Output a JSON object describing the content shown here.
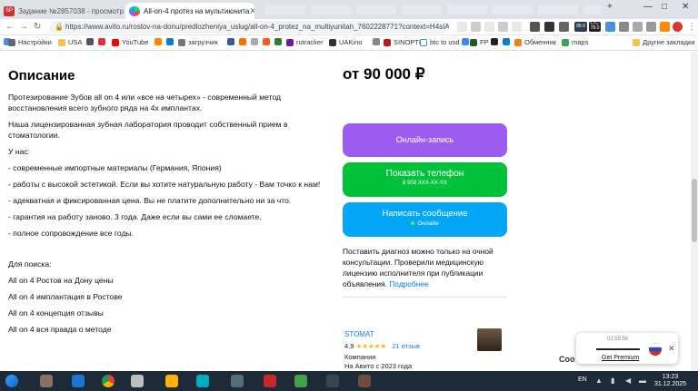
{
  "browser": {
    "tabs": [
      {
        "title": "Задание №2857038 - просмотр з",
        "favicon_label": "SP",
        "active": false
      },
      {
        "title": "All-on-4 протез на мультиюнита",
        "active": true
      }
    ],
    "url": "https://www.avito.ru/rostov-na-donu/predlozheniya_uslug/all-on-4_protez_na_multiyunitah_7602228771?context=H4sIAAAAA...",
    "bookmarks": [
      "Настройки",
      "USA",
      "YouTube",
      "загрузчик",
      "rutracker",
      "UAKino",
      "SINOPTIK",
      "btc to usd",
      "FP",
      "Обменник",
      "maps",
      "Другие закладки"
    ],
    "extension_badges": {
      "ltc": "LTC",
      "ltc_value": "78.0",
      "btc_value": "88.0"
    }
  },
  "listing": {
    "description_title": "Описание",
    "description_paragraphs": [
      "Протезирование Зубов all on 4 или «все на четырех» - современный метод восстановления всего зубного ряда на 4х имплантах.",
      "Наша лицензированная зубная лаборатория проводит собственный прием в стоматологии.",
      "У нас:",
      "- современные импортные материалы (Германия, Япония)",
      "- работы с высокой эстетикой. Если вы хотите натуральную работу - Вам точко к нам!",
      "- адекватная и фиксированная цена. Вы не платите дополнительно ни за что.",
      "- гарантия на работу заново. 3 года. Даже если вы сами ее сломаете.",
      "- полное сопровождение все годы.",
      "",
      "Для поиска:",
      "All on 4 Ростов на Дону цены",
      "All on 4 имплантация в Ростове",
      "All on 4 концепция отзывы",
      "All on 4 вся правда о методе"
    ],
    "price": "от 90 000 ₽",
    "book_button": "Онлайн-запись",
    "phone_button": {
      "label": "Показать телефон",
      "number": "8 958 XXX-XX-XX"
    },
    "message_button": {
      "label": "Написать сообщение",
      "status": "Онлайн"
    },
    "diagnosis_note": "Поставить диагноз можно только на очной консультации. Проверили медицинскую лицензию исполнителя при публикации объявления.",
    "diagnosis_link": "Подробнее",
    "seller": {
      "name": "STOMAT",
      "rating": "4,9",
      "stars": "★★★★★",
      "reviews": "21 отзыв",
      "type": "Компания",
      "since": "На Авито с 2023 года"
    },
    "colors": {
      "book": "#9d5cf0",
      "phone": "#00c23a",
      "message": "#03a7f5",
      "link": "#0a7bd6"
    }
  },
  "vpn_popup": {
    "timer": "02:55:56",
    "premium": "Get Premium",
    "side_label": "Coo"
  },
  "taskbar": {
    "lang": "EN",
    "time": "13:23",
    "date": "31.12.2025"
  }
}
